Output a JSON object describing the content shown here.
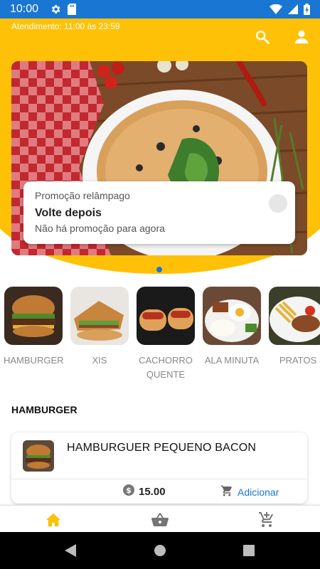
{
  "status_bar": {
    "time": "10:00",
    "icons": [
      "gear-icon",
      "sd-card-icon",
      "wifi-icon",
      "signal-icon",
      "battery-icon"
    ]
  },
  "header": {
    "hours": "Atendimento: 11:00 às 23:59",
    "icons": [
      "search-icon",
      "account-icon"
    ]
  },
  "promo": {
    "kicker": "Promoção relâmpago",
    "title": "Volte depois",
    "message": "Não há promoção para agora"
  },
  "categories": [
    {
      "label": "HAMBURGER"
    },
    {
      "label": "XIS"
    },
    {
      "label": "CACHORRO QUENTE"
    },
    {
      "label": "ALA MINUTA"
    },
    {
      "label": "PRATOS"
    }
  ],
  "section": {
    "title": "HAMBURGER"
  },
  "product": {
    "name": "HAMBURGUER PEQUENO BACON",
    "price": "15.00",
    "add_label": "Adicionar"
  },
  "bottom_nav": [
    "home-icon",
    "basket-icon",
    "cart-add-icon"
  ],
  "colors": {
    "accent": "#ffc107",
    "primary": "#1976d2"
  }
}
